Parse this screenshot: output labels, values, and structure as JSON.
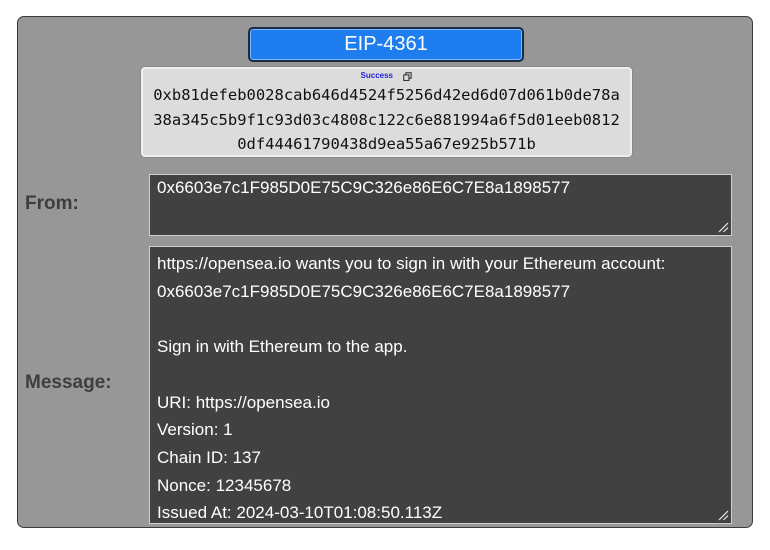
{
  "header": {
    "title": "EIP-4361"
  },
  "signature": {
    "status": "Success",
    "copy_icon": "copy-icon",
    "value": "0xb81defeb0028cab646d4524f5256d42ed6d07d061b0de78a38a345c5b9f1c93d03c4808c122c6e881994a6f5d01eeb08120df44461790438d9ea55a67e925b571b"
  },
  "from": {
    "label": "From:",
    "value": "0x6603e7c1F985D0E75C9C326e86E6C7E8a1898577"
  },
  "message": {
    "label": "Message:",
    "value": "https://opensea.io wants you to sign in with your Ethereum account:\n0x6603e7c1F985D0E75C9C326e86E6C7E8a1898577\n\nSign in with Ethereum to the app.\n\nURI: https://opensea.io\nVersion: 1\nChain ID: 137\nNonce: 12345678\nIssued At: 2024-03-10T01:08:50.113Z"
  },
  "colors": {
    "panel_bg": "#979797",
    "title_button": "#1e7ef0",
    "field_bg": "#414141",
    "status_text": "#1f1fe0"
  }
}
